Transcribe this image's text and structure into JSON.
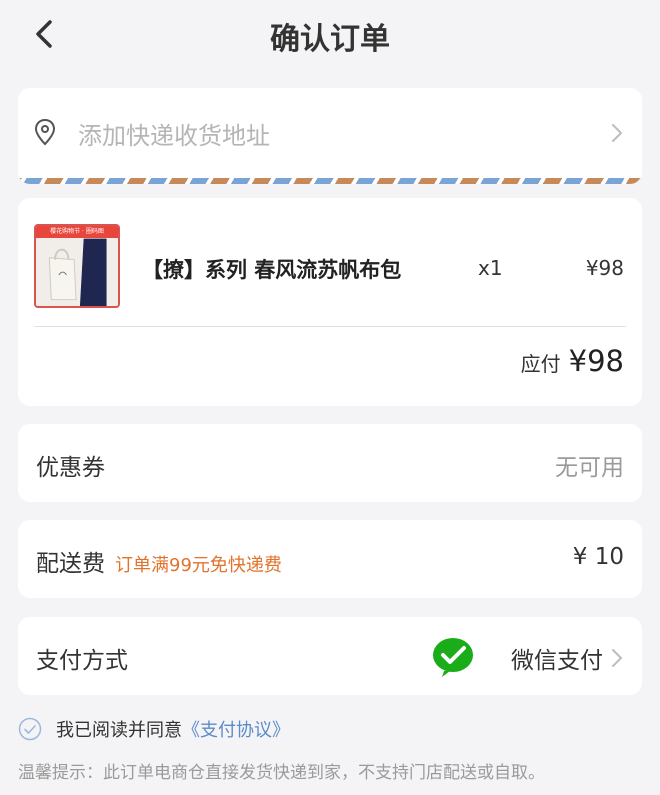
{
  "header": {
    "title": "确认订单",
    "back_icon": "chevron-left-icon"
  },
  "address": {
    "placeholder": "添加快递收货地址",
    "icon": "location-pin-icon"
  },
  "goods": {
    "thumb_banner": "樱花购物节 · 圈码图",
    "name": "【撩】系列 春风流苏帆布包",
    "quantity": "x1",
    "price": "¥98",
    "payable_label": "应付",
    "payable_amount": "¥98"
  },
  "coupon": {
    "label": "优惠券",
    "value": "无可用"
  },
  "shipping": {
    "label": "配送费",
    "promo": "订单满99元免快递费",
    "fee": "¥ 10"
  },
  "payment": {
    "label": "支付方式",
    "method": "微信支付",
    "icon": "wechat-pay-icon"
  },
  "agreement": {
    "text": "我已阅读并同意",
    "link": "《支付协议》"
  },
  "tip": "温馨提示：此订单电商仓直接发货快递到家，不支持门店配送或自取。",
  "colors": {
    "accent_orange": "#e2732d",
    "link_blue": "#5b8bc9",
    "wechat_green": "#1aad19"
  }
}
